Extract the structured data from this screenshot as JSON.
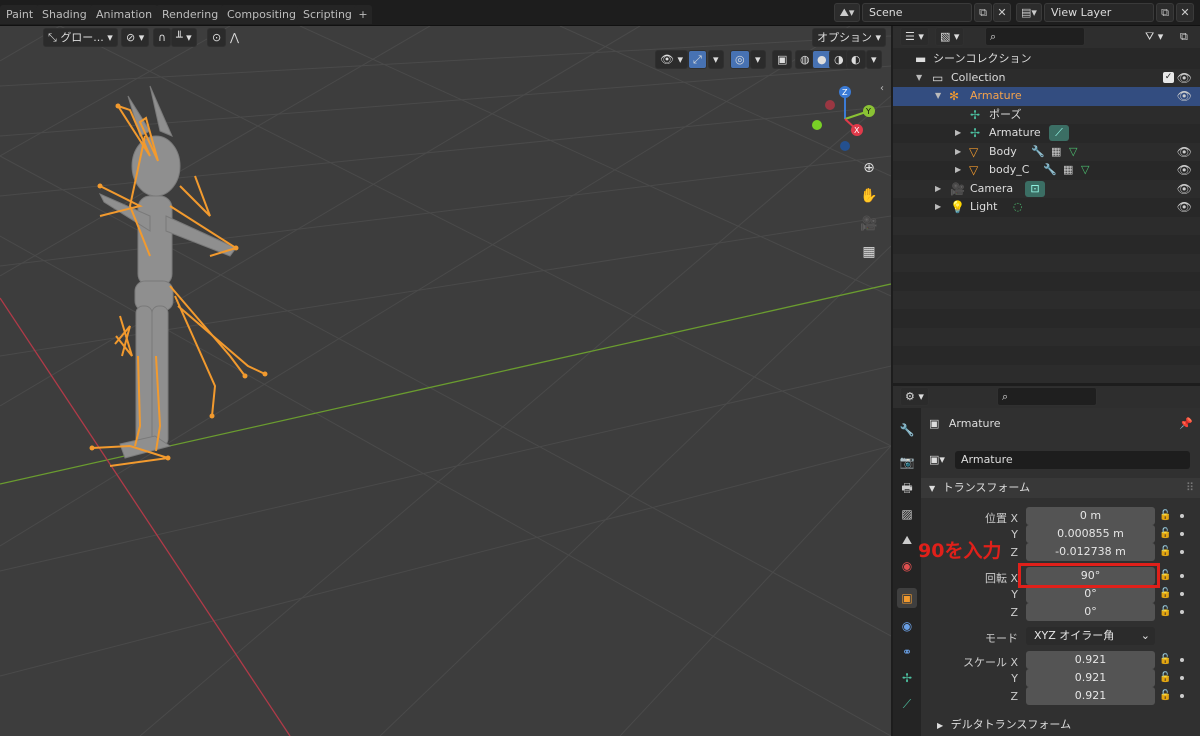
{
  "topbar": {
    "tabs": [
      "Paint",
      "Shading",
      "Animation",
      "Rendering",
      "Compositing",
      "Scripting"
    ],
    "add_tab": "+",
    "scene_name": "Scene",
    "view_layer_name": "View Layer"
  },
  "viewport": {
    "orientation_label": "グロー...",
    "options_label": "オプション",
    "gizmo_x": "X",
    "gizmo_y": "Y",
    "gizmo_z": "Z"
  },
  "outliner": {
    "search_placeholder": "",
    "rows": [
      {
        "label": "シーンコレクション"
      },
      {
        "label": "Collection"
      },
      {
        "label": "Armature"
      },
      {
        "label": "ポーズ"
      },
      {
        "label": "Armature"
      },
      {
        "label": "Body"
      },
      {
        "label": "body_C"
      },
      {
        "label": "Camera"
      },
      {
        "label": "Light"
      }
    ]
  },
  "properties": {
    "object_title": "Armature",
    "object_name_field": "Armature",
    "transform_header": "トランスフォーム",
    "location_label": "位置 X",
    "location": {
      "x": "0 m",
      "y": "0.000855 m",
      "z": "-0.012738 m"
    },
    "rotation_label": "回転 X",
    "rotation": {
      "x": "90°",
      "y": "0°",
      "z": "0°"
    },
    "mode_label": "モード",
    "mode_value": "XYZ オイラー角",
    "scale_label": "スケール X",
    "scale": {
      "x": "0.921",
      "y": "0.921",
      "z": "0.921"
    },
    "axis_y": "Y",
    "axis_z": "Z",
    "delta_header": "デルタトランスフォーム"
  },
  "annotation": {
    "text": "90を入力",
    "color": "#e0201a"
  },
  "colors": {
    "selection": "#334d80",
    "accent_blue": "#4772b3",
    "bone_orange": "#f29a2e",
    "x_axis": "#b03a48",
    "y_axis": "#6a9c2f"
  }
}
